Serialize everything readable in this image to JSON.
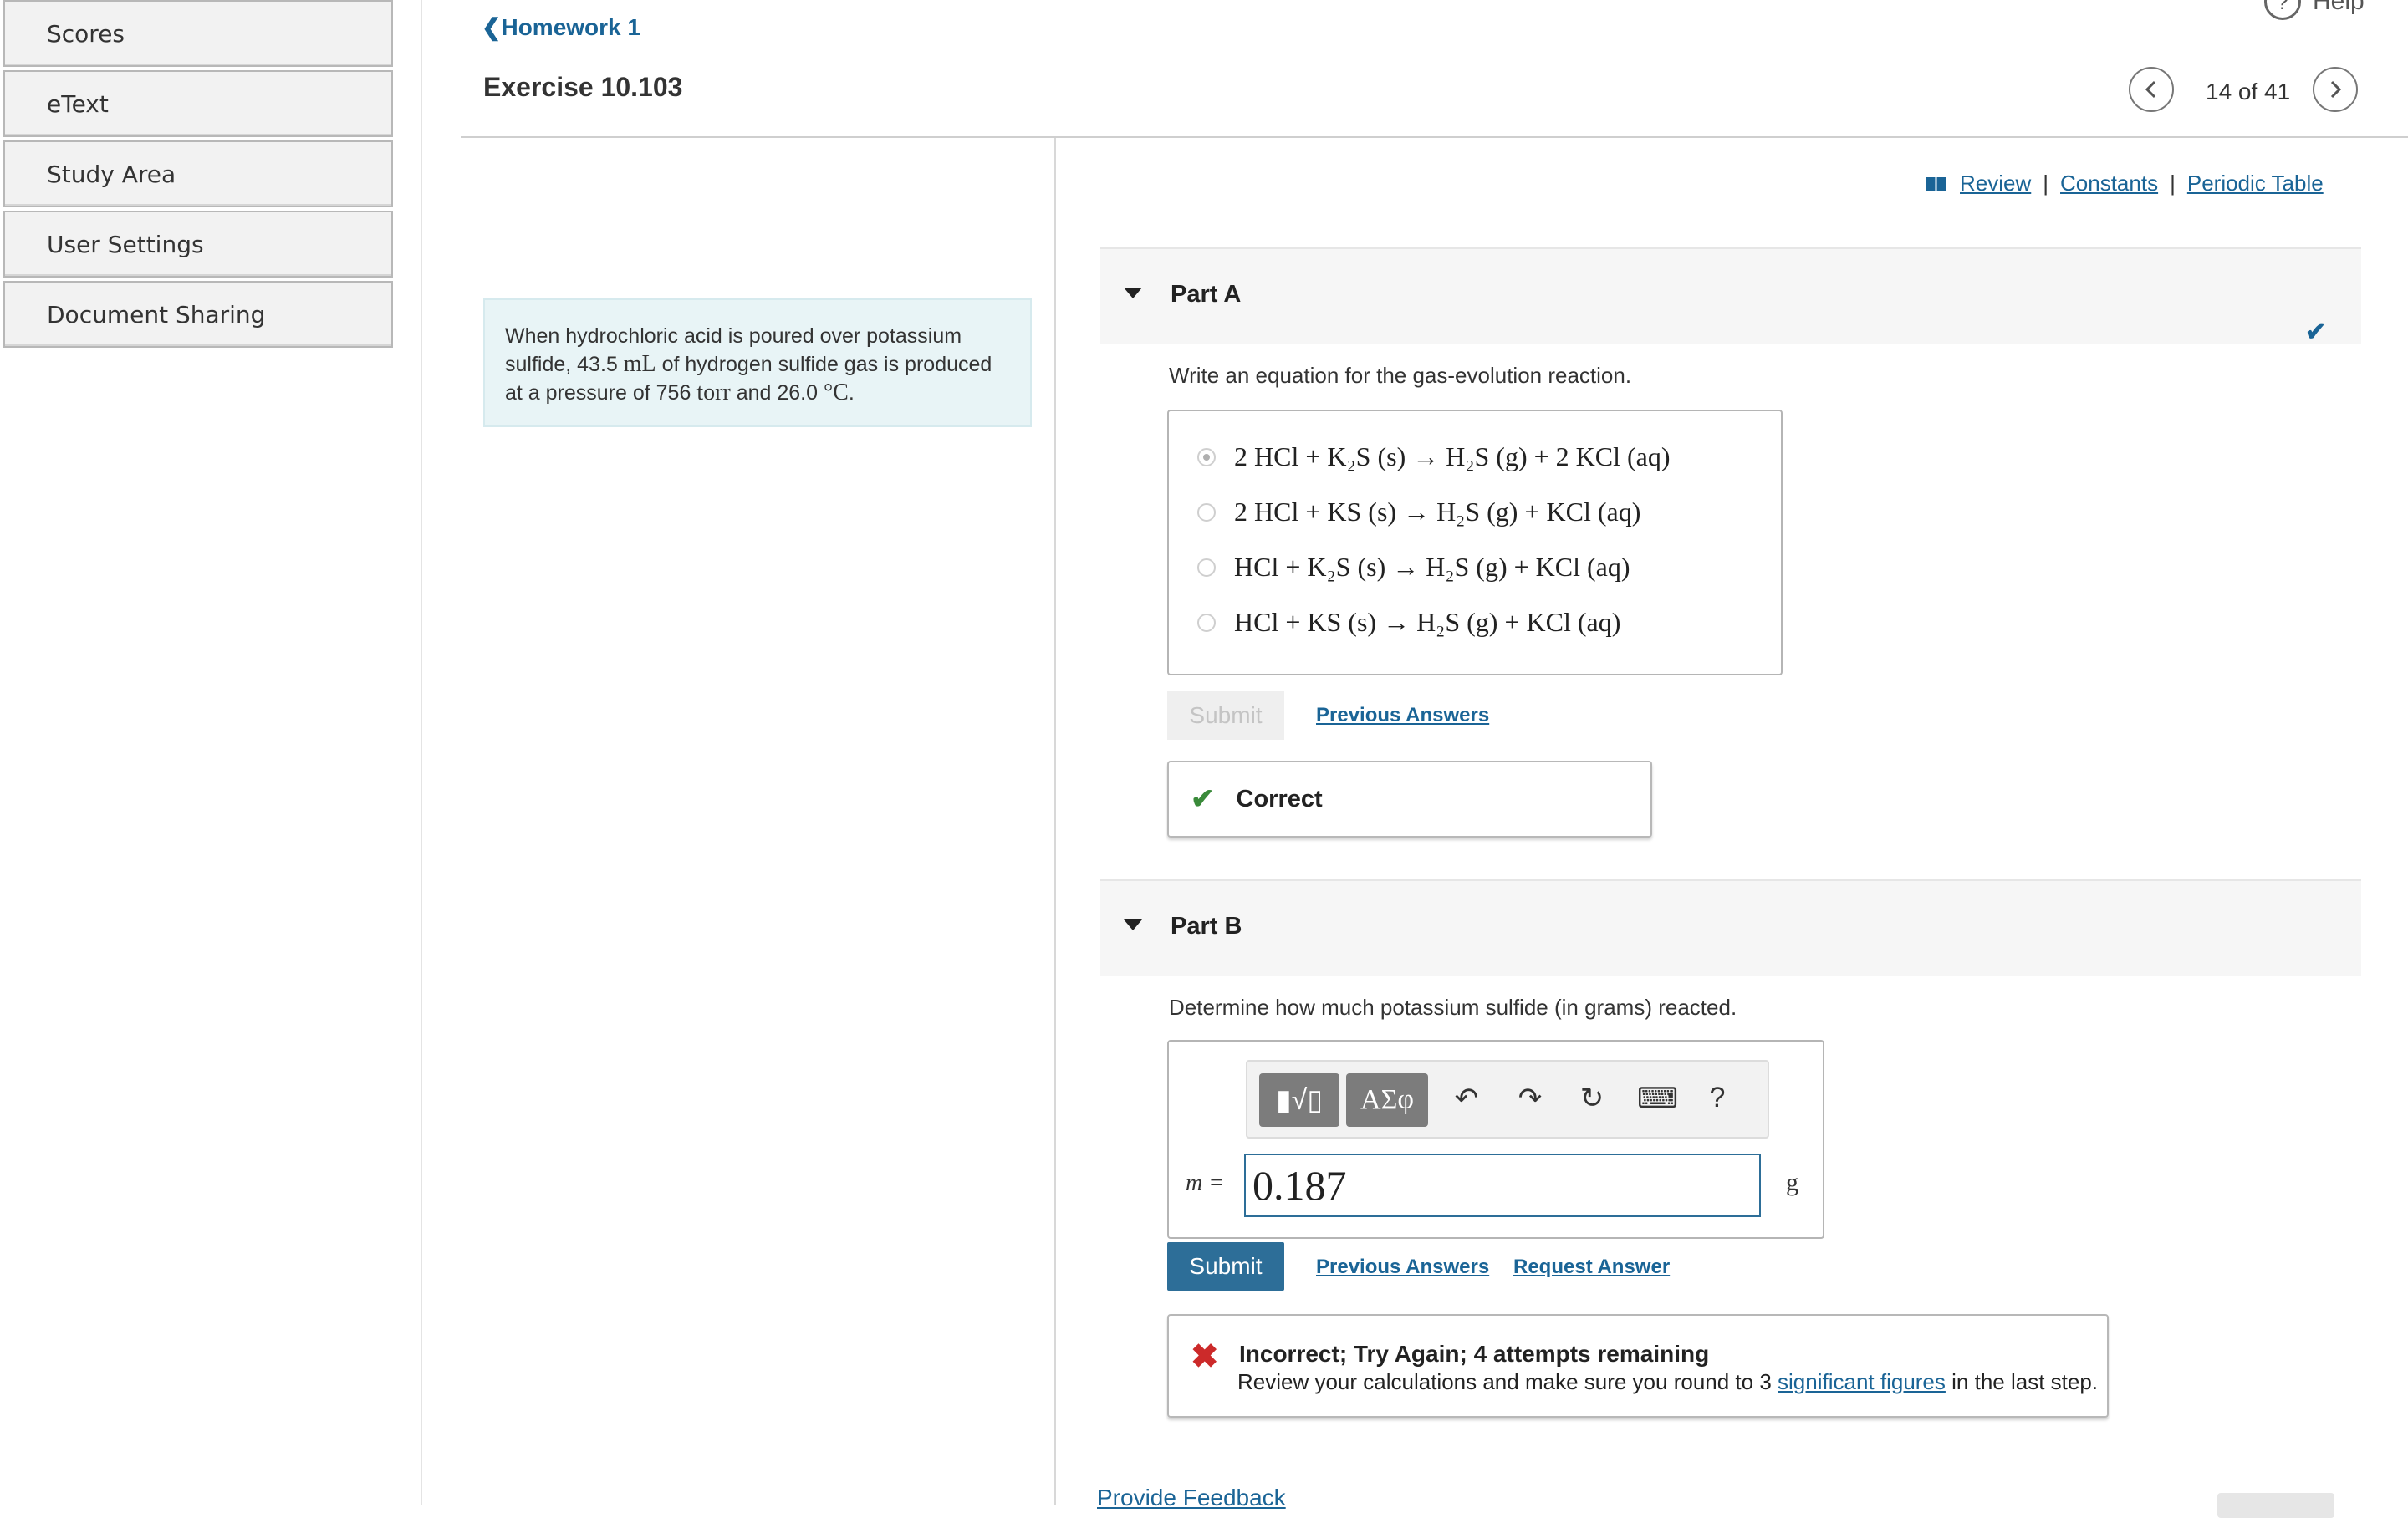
{
  "sidebar": {
    "items": [
      {
        "label": "Scores"
      },
      {
        "label": "eText"
      },
      {
        "label": "Study Area"
      },
      {
        "label": "User Settings"
      },
      {
        "label": "Document Sharing"
      }
    ]
  },
  "header": {
    "back_label": "Homework 1",
    "title": "Exercise 10.103",
    "help_label": "Help",
    "pager": "14 of 41"
  },
  "problem": {
    "text_1": "When hydrochloric acid is poured over potassium sulfide, 43.5 ",
    "unit_volume": "mL",
    "text_2": " of hydrogen sulfide gas is produced at a pressure of 756 ",
    "unit_pressure": "torr",
    "text_3": " and 26.0 ",
    "unit_temp": "°C",
    "text_4": "."
  },
  "resources": {
    "review": "Review",
    "constants": "Constants",
    "periodic_table": "Periodic Table",
    "separator": "|"
  },
  "part_a": {
    "label": "Part A",
    "prompt": "Write an equation for the gas-evolution reaction.",
    "choices": [
      {
        "text": "2 HCl + K₂S (s) → H₂S (g) + 2 KCl (aq)",
        "selected": true
      },
      {
        "text": "2 HCl + KS (s) → H₂S (g) + KCl (aq)",
        "selected": false
      },
      {
        "text": "HCl + K₂S (s) → H₂S (g) + KCl (aq)",
        "selected": false
      },
      {
        "text": "HCl + KS (s) → H₂S (g) + KCl (aq)",
        "selected": false
      }
    ],
    "submit_label": "Submit",
    "previous_answers": "Previous Answers",
    "feedback": "Correct"
  },
  "part_b": {
    "label": "Part B",
    "prompt": "Determine how much potassium sulfide (in grams) reacted.",
    "toolbar": {
      "templates_glyph": "▮√▯",
      "symbols_glyph": "ΑΣφ",
      "undo_glyph": "↶",
      "redo_glyph": "↷",
      "reset_glyph": "↻",
      "keyboard_glyph": "⌨",
      "help_glyph": "?"
    },
    "variable": "m =",
    "answer_value": "0.187",
    "unit": "g",
    "submit_label": "Submit",
    "previous_answers": "Previous Answers",
    "request_answer": "Request Answer",
    "feedback_title": "Incorrect; Try Again; 4 attempts remaining",
    "feedback_text_1": "Review your calculations and make sure you round to 3 ",
    "feedback_link": "significant figures",
    "feedback_text_2": " in the last step."
  },
  "footer": {
    "provide_feedback": "Provide Feedback"
  },
  "colors": {
    "link": "#1a6496",
    "submit_bg": "#2d6e98",
    "correct": "#3a8a3a",
    "incorrect": "#cc2a2a",
    "problem_bg": "#e8f4f6"
  }
}
